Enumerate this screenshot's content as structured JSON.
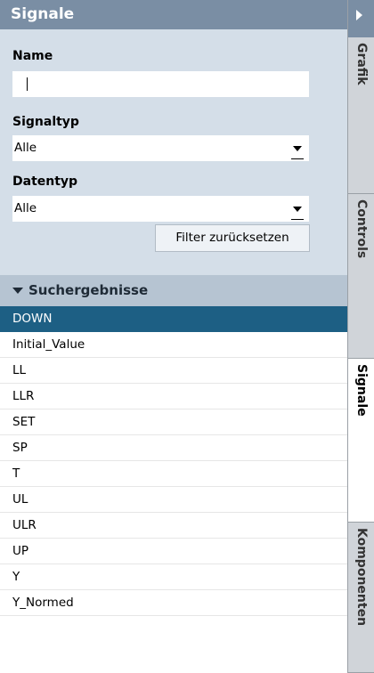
{
  "panel": {
    "title": "Signale"
  },
  "filter": {
    "name_label": "Name",
    "name_value": "",
    "signaltyp_label": "Signaltyp",
    "signaltyp_value": "Alle",
    "datentyp_label": "Datentyp",
    "datentyp_value": "Alle",
    "reset_label": "Filter zurücksetzen"
  },
  "results": {
    "header": "Suchergebnisse",
    "items": [
      "DOWN",
      "Initial_Value",
      "LL",
      "LLR",
      "SET",
      "SP",
      "T",
      "UL",
      "ULR",
      "UP",
      "Y",
      "Y_Normed"
    ],
    "selected": "DOWN"
  },
  "tabs": [
    {
      "label": "Grafik"
    },
    {
      "label": "Controls"
    },
    {
      "label": "Signale"
    },
    {
      "label": "Komponenten"
    }
  ],
  "colors": {
    "header_bg": "#7a8ea4",
    "filter_bg": "#d4dee8",
    "selected_bg": "#1d5f84"
  }
}
